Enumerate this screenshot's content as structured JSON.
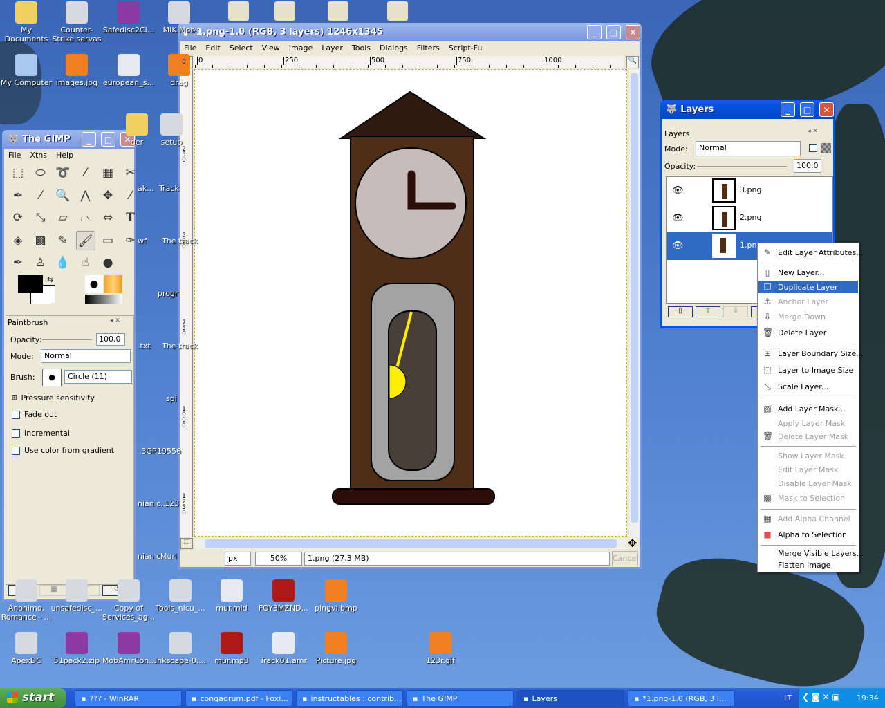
{
  "desktop": {
    "icons_top": [
      {
        "label": "My Documents",
        "icon": "folder-documents-icon"
      },
      {
        "label": "Counter-Strike servas",
        "icon": "counter-strike-shortcut-icon"
      },
      {
        "label": "Safedisc2Cl...",
        "icon": "winrar-archive-icon"
      },
      {
        "label": "MIK Mob",
        "icon": "audio-app-shortcut-icon"
      },
      {
        "label": "My Computer",
        "icon": "computer-icon"
      },
      {
        "label": "images.jpg",
        "icon": "jpg-file-icon"
      },
      {
        "label": "european_s...",
        "icon": "media-file-icon"
      },
      {
        "label": "drag",
        "icon": "jpg-file-icon"
      },
      {
        "label": "der",
        "icon": "folder-icon"
      },
      {
        "label": "setup",
        "icon": "setup-icon"
      }
    ],
    "icons_column": [
      "ak...",
      "Track",
      "wf",
      "The track",
      "progr",
      ".txt",
      "The track",
      "spi",
      ".3GP",
      "19556",
      "nian c...",
      "123",
      "nian c...",
      "Muri"
    ],
    "icons_row1": [
      {
        "label": "Anonimo, Romance - ...",
        "icon": "audio-file-icon"
      },
      {
        "label": "unsafedisc_...",
        "icon": "archive-icon"
      },
      {
        "label": "Copy of Services_ag...",
        "icon": "file-icon"
      },
      {
        "label": "Tools_nicu_...",
        "icon": "inkscape-file-icon"
      },
      {
        "label": "mur.mid",
        "icon": "media-file-icon"
      },
      {
        "label": "FOY3MZND...",
        "icon": "mp3-file-icon"
      },
      {
        "label": "pingvi.bmp",
        "icon": "bmp-file-icon"
      }
    ],
    "icons_row2": [
      {
        "label": "ApexDC",
        "icon": "apexdc-shortcut-icon"
      },
      {
        "label": "51pack2.zip",
        "icon": "winrar-archive-icon"
      },
      {
        "label": "MobAmrCon...",
        "icon": "winrar-archive-icon"
      },
      {
        "label": "Inkscape-0....",
        "icon": "installer-icon"
      },
      {
        "label": "mur.mp3",
        "icon": "mp3-file-icon"
      },
      {
        "label": "Track01.amr",
        "icon": "media-file-icon"
      },
      {
        "label": "Picture.jpg",
        "icon": "jpg-file-icon"
      },
      {
        "label": "123r.gif",
        "icon": "gif-file-icon"
      }
    ]
  },
  "toolbox": {
    "title": "The GIMP",
    "menu": [
      "File",
      "Xtns",
      "Help"
    ],
    "tools": [
      "rect-select",
      "ellipse-select",
      "free-select",
      "fuzzy-select",
      "select-by-color",
      "scissors",
      "paths",
      "color-picker",
      "zoom",
      "measure",
      "move",
      "crop",
      "rotate",
      "scale",
      "shear",
      "perspective",
      "flip",
      "text",
      "bucket-fill",
      "blend",
      "pencil",
      "paintbrush",
      "eraser",
      "airbrush",
      "ink",
      "clone",
      "convolve",
      "smudge",
      "dodge-burn"
    ],
    "active_tool": "paintbrush",
    "fg_color": "#000000",
    "bg_color": "#ffffff",
    "options": {
      "title": "Paintbrush",
      "opacity_label": "Opacity:",
      "opacity": "100,0",
      "mode_label": "Mode:",
      "mode": "Normal",
      "brush_label": "Brush:",
      "brush": "Circle (11)",
      "pressure": "Pressure sensitivity",
      "checks": [
        {
          "label": "Fade out",
          "checked": false
        },
        {
          "label": "Incremental",
          "checked": false
        },
        {
          "label": "Use color from gradient",
          "checked": false
        }
      ]
    }
  },
  "image_window": {
    "title": "*1.png-1.0 (RGB, 3 layers) 1246x1345",
    "menu": [
      "File",
      "Edit",
      "Select",
      "View",
      "Image",
      "Layer",
      "Tools",
      "Dialogs",
      "Filters",
      "Script-Fu"
    ],
    "hruler": [
      "0",
      "250",
      "500",
      "750",
      "1000"
    ],
    "vruler": [
      "0",
      "250",
      "500",
      "750",
      "1000",
      "1250"
    ],
    "unit": "px",
    "zoom": "50%",
    "status": "1.png (27,3 MB)",
    "cancel": "Cancel",
    "colors": {
      "roof": "#2e1a10",
      "body": "#4f2e17",
      "face": "#c6bcb8",
      "hands": "#2b0d0a",
      "case": "#a3a3a3",
      "inner": "#4a3e38",
      "pendulum": "#ffee00",
      "base": "#2b0d0a"
    }
  },
  "layers": {
    "title": "Layers",
    "panel_title": "Layers",
    "mode_label": "Mode:",
    "mode": "Normal",
    "opacity_label": "Opacity:",
    "opacity": "100,0",
    "items": [
      {
        "name": "3.png",
        "visible": true,
        "selected": false
      },
      {
        "name": "2.png",
        "visible": true,
        "selected": false
      },
      {
        "name": "1.png",
        "visible": true,
        "selected": true
      }
    ]
  },
  "context_menu": {
    "items": [
      {
        "label": "Edit Layer Attributes...",
        "icon": "edit-attributes-icon",
        "enabled": true
      },
      {
        "sep": true
      },
      {
        "label": "New Layer...",
        "icon": "new-layer-icon",
        "enabled": true
      },
      {
        "label": "Duplicate Layer",
        "icon": "duplicate-icon",
        "enabled": true,
        "selected": true
      },
      {
        "label": "Anchor Layer",
        "icon": "anchor-icon",
        "enabled": false
      },
      {
        "label": "Merge Down",
        "icon": "merge-down-icon",
        "enabled": false
      },
      {
        "label": "Delete Layer",
        "icon": "trash-icon",
        "enabled": true
      },
      {
        "sep": true
      },
      {
        "label": "Layer Boundary Size...",
        "icon": "boundary-size-icon",
        "enabled": true
      },
      {
        "label": "Layer to Image Size",
        "icon": "layer-to-image-icon",
        "enabled": true
      },
      {
        "label": "Scale Layer...",
        "icon": "scale-layer-icon",
        "enabled": true
      },
      {
        "sep": true
      },
      {
        "label": "Add Layer Mask...",
        "icon": "add-mask-icon",
        "enabled": true
      },
      {
        "label": "Apply Layer Mask",
        "icon": "",
        "enabled": false
      },
      {
        "label": "Delete Layer Mask",
        "icon": "trash-icon",
        "enabled": false
      },
      {
        "sep": true
      },
      {
        "label": "Show Layer Mask",
        "icon": "",
        "enabled": false
      },
      {
        "label": "Edit Layer Mask",
        "icon": "",
        "enabled": false
      },
      {
        "label": "Disable Layer Mask",
        "icon": "",
        "enabled": false
      },
      {
        "label": "Mask to Selection",
        "icon": "mask-selection-icon",
        "enabled": false
      },
      {
        "sep": true
      },
      {
        "label": "Add Alpha Channel",
        "icon": "alpha-channel-icon",
        "enabled": false
      },
      {
        "label": "Alpha to Selection",
        "icon": "alpha-selection-icon",
        "enabled": true
      },
      {
        "sep": true
      },
      {
        "label": "Merge Visible Layers...",
        "icon": "",
        "enabled": true
      },
      {
        "label": "Flatten Image",
        "icon": "",
        "enabled": true
      }
    ]
  },
  "taskbar": {
    "start": "start",
    "tasks": [
      {
        "label": "??? - WinRAR",
        "icon": "winrar-icon"
      },
      {
        "label": "congadrum.pdf - Foxi...",
        "icon": "pdf-icon"
      },
      {
        "label": "instructables : contrib...",
        "icon": "firefox-icon"
      },
      {
        "label": "The GIMP",
        "icon": "gimp-icon"
      },
      {
        "label": "Layers",
        "icon": "gimp-icon",
        "active": true
      },
      {
        "label": "*1.png-1.0 (RGB, 3 l...",
        "icon": "image-icon"
      }
    ],
    "lang": "LT",
    "clock": "19:34"
  }
}
